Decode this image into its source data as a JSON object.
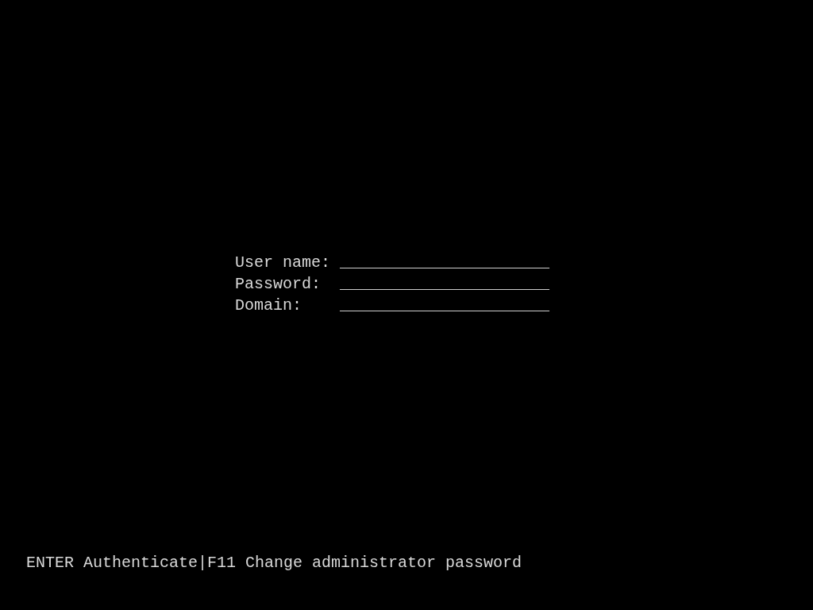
{
  "login_fields": [
    {
      "label": "User name:",
      "blank": "______________________"
    },
    {
      "label": "Password:",
      "blank": "______________________"
    },
    {
      "label": "Domain:",
      "blank": "______________________"
    }
  ],
  "status_bar": "ENTER Authenticate|F11 Change administrator password"
}
